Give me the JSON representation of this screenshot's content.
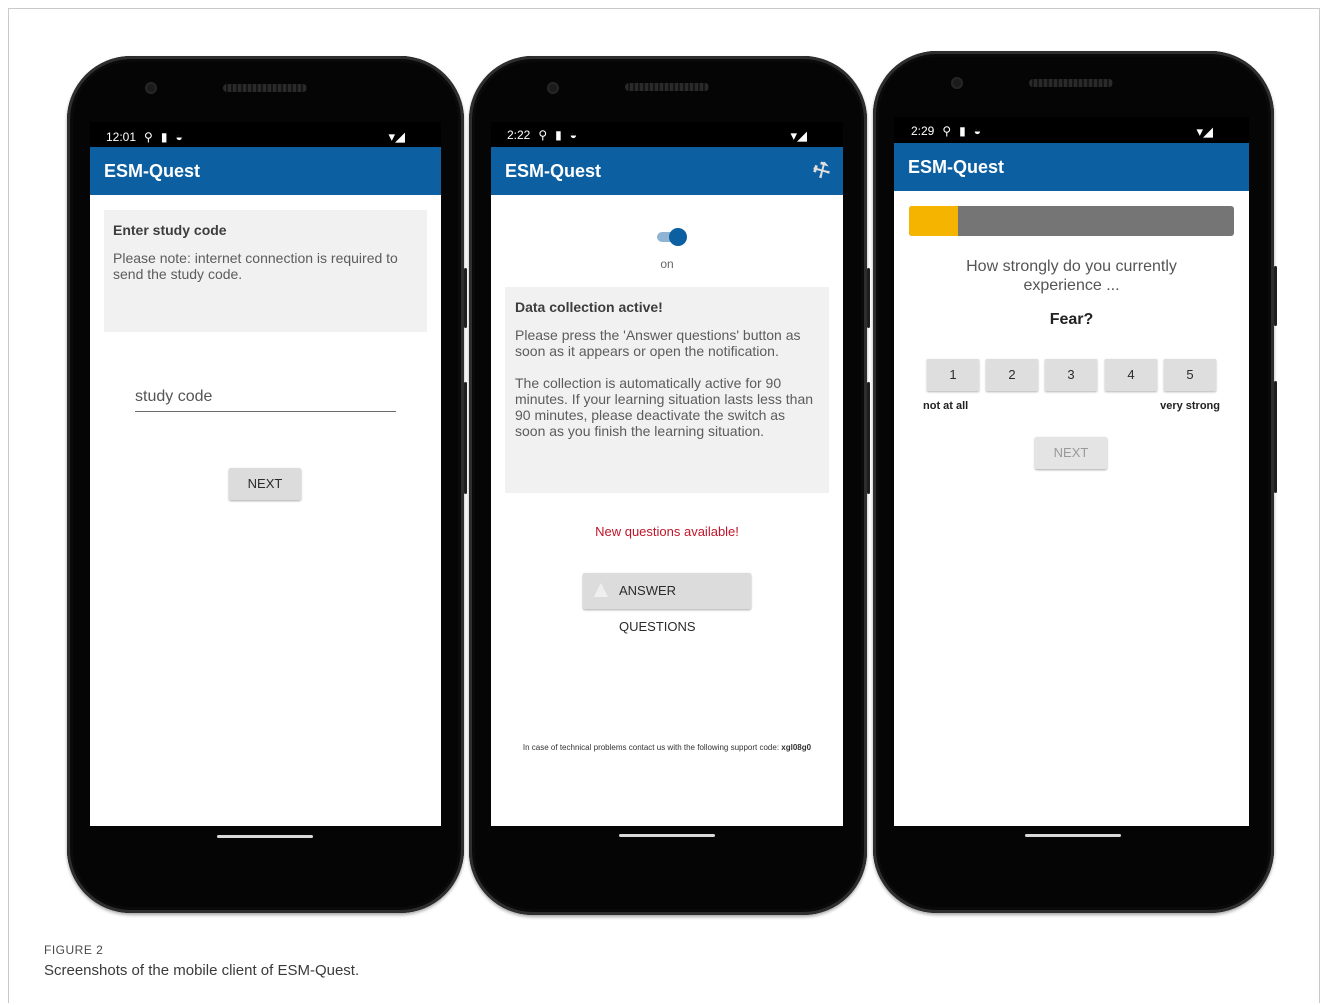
{
  "figure": {
    "label": "FIGURE 2",
    "caption": "Screenshots of the mobile client of ESM-Quest."
  },
  "colors": {
    "appbar": "#0c5fa0",
    "alert_text": "#c0152a",
    "progress_fill": "#f4b400",
    "progress_track": "#757575"
  },
  "phone1": {
    "status_time": "12:01",
    "app_title": "ESM-Quest",
    "info_heading": "Enter study code",
    "info_body": "Please note: internet connection is required to send the study code.",
    "input_placeholder": "study code",
    "next_label": "NEXT"
  },
  "phone2": {
    "status_time": "2:22",
    "app_title": "ESM-Quest",
    "settings_icon": "wrench-icon",
    "toggle_state": true,
    "toggle_label": "on",
    "info_heading": "Data collection active!",
    "info_para1": "Please press the 'Answer questions' button as soon as it appears or open the notification.",
    "info_para2": "The collection is automatically active for 90 minutes. If your learning situation lasts less than 90 minutes, please deactivate the switch as soon as you finish the learning situation.",
    "alert": "New questions available!",
    "answer_label": "ANSWER QUESTIONS",
    "support_text": "In case of technical problems contact us with the following support code:",
    "support_code": "xgl08g0"
  },
  "phone3": {
    "status_time": "2:29",
    "app_title": "ESM-Quest",
    "progress_fraction": 0.15,
    "question": "How strongly do you currently experience ...",
    "emotion": "Fear?",
    "scale": [
      "1",
      "2",
      "3",
      "4",
      "5"
    ],
    "scale_min_label": "not at all",
    "scale_max_label": "very strong",
    "next_label": "NEXT"
  }
}
